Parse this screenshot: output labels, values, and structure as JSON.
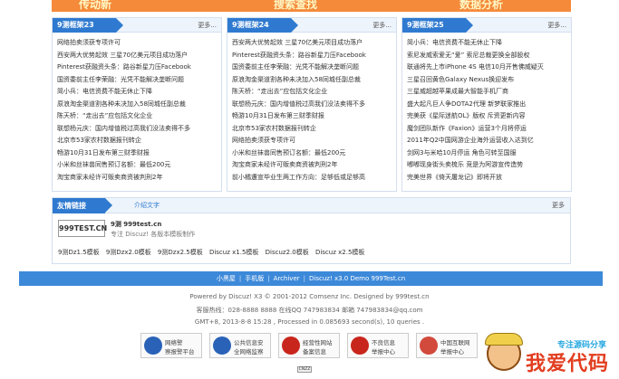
{
  "banner": {
    "texts": [
      "传动新",
      "搜索查找",
      "数据分析"
    ]
  },
  "boxes": [
    {
      "title": "9测框架23",
      "more": "更多...",
      "items": [
        "网络拍卖须获专项许可",
        "西安两大优势起效 三星70亿美元项目成功落户",
        "Pinterest获融资头条：路谷新星力压Facebook",
        "国资委前主任李荣融：光凭不能解决垄断问题",
        "简小兵：电信资费不能无休止下降",
        "原浪淘金渠道割各种未决加入58同城任副总裁",
        "陈天桥：“走出去”应包括文化企业",
        "联想杨元庆：国内增值税过高我们没法卖得不多",
        "北京市53家农村数据报刊转企",
        "畅游10月31日发布第三财季财报",
        "小米和丝袜兽同售预订名额：最低200元",
        "淘宝商家未经许可贩卖商资被判刑2年"
      ]
    },
    {
      "title": "9测框架24",
      "more": "更多...",
      "items": [
        "西安两大优势起效 三星70亿美元项目成功落户",
        "Pinterest获融资头条：路谷新星力压Facebook",
        "国资委前主任李荣融：光凭不能解决垄断问题",
        "原浪淘金渠道割各种未决加入58同城任副总裁",
        "陈天桥：“走出去”应包括文化企业",
        "联想杨元庆：国内增值税过高我们没法卖得不多",
        "畅游10月31日发布第三财季财报",
        "北京市53家农村数据报刊转企",
        "网络拍卖须获专项许可",
        "小米和丝袜兽同售预订名额：最低200元",
        "淘宝商家未经许可贩卖商资被判刑2年",
        "前小橘遭宣毕业生两工作方向：足够低或足够高"
      ]
    },
    {
      "title": "9测框架25",
      "more": "更多...",
      "items": [
        "简小兵：电信资费不能无休止下降",
        "索尼发威索爱无“爱” 索尼总裁更换全部股权",
        "联通将先上市iPhone 4S 电信10月开售佛威疑灭",
        "三星召回黄色Galaxy Nexus换迎发布",
        "三星威超越苹果成最大智能手机厂商",
        "盛大起凡巨人争DOTA2代理 新梦联家推出",
        "完美获《星际迷航OL》版权 斥资更新内容",
        "魔剑团队新作《Faxion》运营3个月将停运",
        "2011年Q2中国网游企业海外运营收入达到亿",
        "剑网3与米哈10月停运 角色可转至国服",
        "嘟嘟现身街头卖梳乐 竞是为阿游宣传造势",
        "完美世界《倚天屠龙记》即将开放"
      ]
    }
  ],
  "links": {
    "title": "友情链接",
    "intro": "介绍文字",
    "more": "更多",
    "logo_text": "999TEST.CN",
    "site_name": "9测 999test.cn",
    "site_desc": "专注 Discuz! 各版本模板制作",
    "text_links": [
      "9测Dz1.5模板",
      "9测Dzx2.0模板",
      "9测Dzx2.5模板",
      "Discuz x1.5模板",
      "Discuz2.0模板",
      "Discuz x2.5模板"
    ]
  },
  "footer": {
    "nav": [
      "小黑屋",
      "手机版",
      "Archiver",
      "Discuz! x3.0 Demo 999Test.cn"
    ],
    "powered": "Powered by Discuz! X3 © 2001-2012 Comsenz Inc. Designed by 999test.cn",
    "contact": "客服热线：028-8888 8888 在线QQ 747983834 邮箱 747983834@qq.com",
    "gmt": "GMT+8, 2013-8-8 15:28 , Processed in 0.085693 second(s), 10 queries .",
    "badges": [
      {
        "l1": "网络警",
        "l2": "察报警平台",
        "color": "#2a62b8"
      },
      {
        "l1": "公共信息安",
        "l2": "全网络监察",
        "color": "#2a62b8"
      },
      {
        "l1": "经营性网站",
        "l2": "备案信息",
        "color": "#c8261c"
      },
      {
        "l1": "不良信息",
        "l2": "举报中心",
        "color": "#c8261c"
      },
      {
        "l1": "中国互联网",
        "l2": "举报中心",
        "color": "#d24a3c"
      }
    ],
    "cnzz": "CNZZ"
  },
  "watermark": {
    "main": "我爱代码",
    "sub": "专注源码分享"
  }
}
